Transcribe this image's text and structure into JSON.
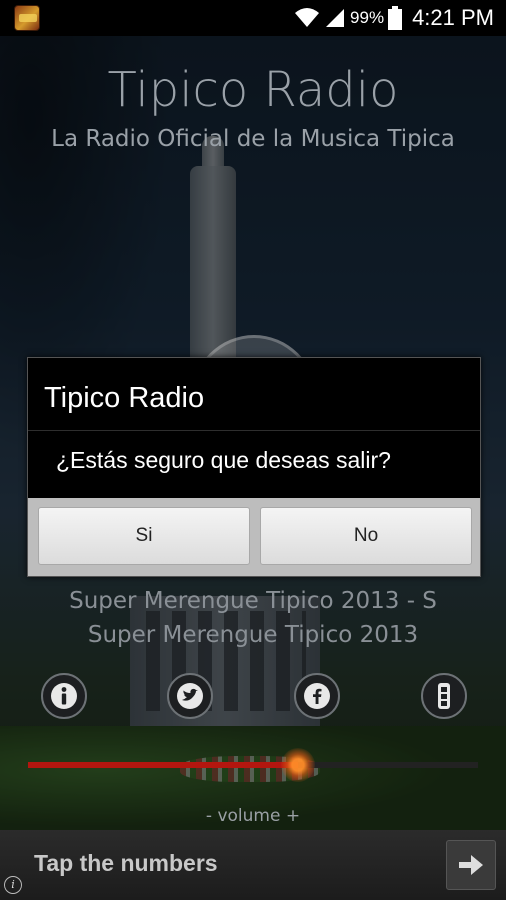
{
  "status_bar": {
    "battery_percent": "99%",
    "time": "4:21 PM",
    "icons": [
      "wifi-icon",
      "signal-icon",
      "battery-icon"
    ]
  },
  "app": {
    "title": "Tipico Radio",
    "subtitle": "La Radio Oficial de la Musica Tipica"
  },
  "now_playing": {
    "line1": "Super Merengue Tipico 2013 - S",
    "line2": "Super Merengue Tipico 2013"
  },
  "controls": {
    "icons": [
      "info-icon",
      "twitter-icon",
      "facebook-icon",
      "menu-icon"
    ]
  },
  "volume": {
    "label": "- volume +",
    "level": 0.6
  },
  "ad": {
    "text": "Tap the numbers"
  },
  "dialog": {
    "title": "Tipico Radio",
    "message": "¿Estás seguro que deseas salir?",
    "positive_label": "Si",
    "negative_label": "No"
  },
  "colors": {
    "seek_fill": "#b3160f",
    "seek_thumb": "#ff8c28",
    "title_text": "#9aa1a8"
  }
}
